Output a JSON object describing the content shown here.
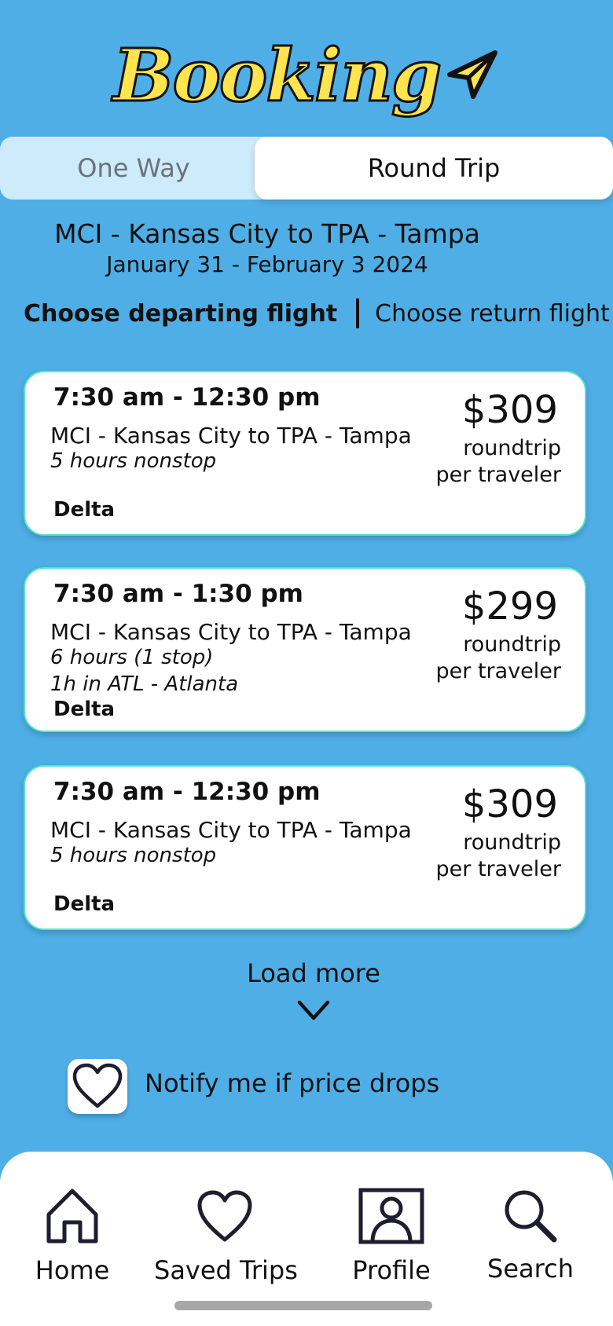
{
  "app": {
    "logo_text": "Booking"
  },
  "tabs": {
    "one_way": "One Way",
    "round_trip": "Round Trip",
    "selected": "Round Trip"
  },
  "trip": {
    "route": "MCI - Kansas City to TPA - Tampa",
    "dates": "January 31 - February 3 2024"
  },
  "steps": {
    "departing": "Choose departing flight",
    "return": "Choose return flight"
  },
  "flights": [
    {
      "time": "7:30 am - 12:30 pm",
      "route": "MCI - Kansas City to TPA - Tampa",
      "duration": "5 hours nonstop",
      "stop_detail": "",
      "airline": "Delta",
      "price": "$309",
      "price_type": "roundtrip",
      "price_basis": "per traveler"
    },
    {
      "time": "7:30 am - 1:30 pm",
      "route": "MCI - Kansas City to TPA - Tampa",
      "duration": "6 hours (1 stop)",
      "stop_detail": "1h in ATL - Atlanta",
      "airline": "Delta",
      "price": "$299",
      "price_type": "roundtrip",
      "price_basis": "per traveler"
    },
    {
      "time": "7:30 am - 12:30 pm",
      "route": "MCI - Kansas City to TPA - Tampa",
      "duration": "5 hours nonstop",
      "stop_detail": "",
      "airline": "Delta",
      "price": "$309",
      "price_type": "roundtrip",
      "price_basis": "per traveler"
    }
  ],
  "load_more": "Load more",
  "notify": {
    "label": "Notify me if price drops",
    "checked": false
  },
  "nav": {
    "home": "Home",
    "saved": "Saved Trips",
    "profile": "Profile",
    "search": "Search"
  },
  "icons": {
    "logo_plane": "paper-plane-icon",
    "load_more": "chevron-down-icon",
    "notify": "heart-icon",
    "home": "home-icon",
    "saved": "heart-icon",
    "profile": "user-icon",
    "search": "search-icon"
  },
  "colors": {
    "background": "#4FAEE6",
    "logo_yellow": "#FFE44D",
    "card_border": "#55E4C9",
    "tab_inactive": "#CDEBFB",
    "nav_icon": "#1E1E2E"
  }
}
